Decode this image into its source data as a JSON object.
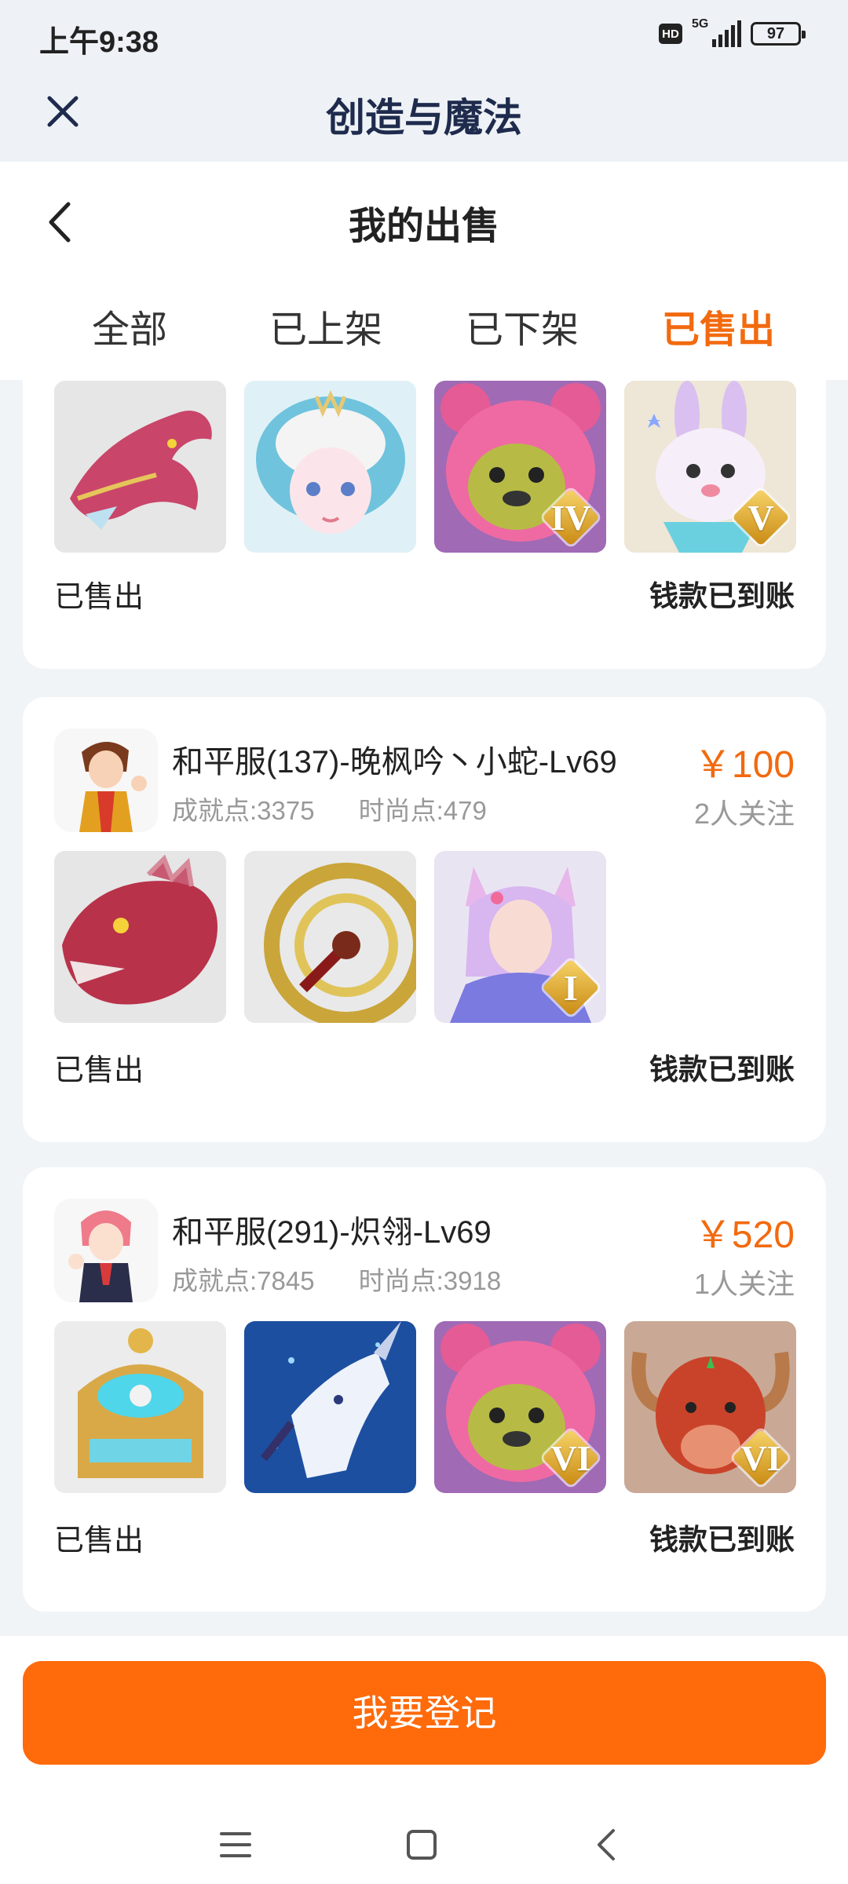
{
  "status_bar": {
    "time": "上午9:38",
    "hd_label": "HD",
    "network_label": "5G",
    "battery": "97"
  },
  "app_bar": {
    "title": "创造与魔法"
  },
  "page": {
    "title": "我的出售"
  },
  "tabs": [
    {
      "label": "全部",
      "active": false
    },
    {
      "label": "已上架",
      "active": false
    },
    {
      "label": "已下架",
      "active": false
    },
    {
      "label": "已售出",
      "active": true
    }
  ],
  "listings": [
    {
      "server": "",
      "item_tiers": [
        "",
        "",
        "IV",
        "V"
      ],
      "status": "已售出",
      "settlement": "钱款已到账"
    },
    {
      "server": "和平服(137)-晚枫吟丶小蛇-Lv69",
      "achievement": "成就点:3375",
      "fashion": "时尚点:479",
      "price": "￥100",
      "followers": "2人关注",
      "item_tiers": [
        "",
        "",
        "I"
      ],
      "status": "已售出",
      "settlement": "钱款已到账"
    },
    {
      "server": "和平服(291)-炽翎-Lv69",
      "achievement": "成就点:7845",
      "fashion": "时尚点:3918",
      "price": "￥520",
      "followers": "1人关注",
      "item_tiers": [
        "",
        "",
        "VI",
        "VI"
      ],
      "status": "已售出",
      "settlement": "钱款已到账"
    }
  ],
  "register_button": "我要登记",
  "colors": {
    "accent": "#f26a0f",
    "button": "#ff6a0a",
    "title": "#1e2b4d"
  }
}
